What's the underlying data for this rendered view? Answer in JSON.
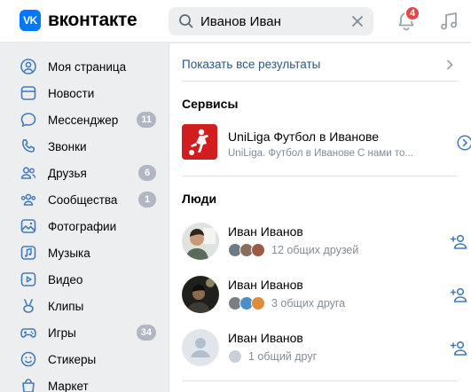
{
  "header": {
    "logo_mark": "VK",
    "logo_text": "вконтакте",
    "search_value": "Иванов Иван",
    "notification_count": "4"
  },
  "sidebar": {
    "items": [
      {
        "label": "Моя страница",
        "icon": "user-circle-icon",
        "count": ""
      },
      {
        "label": "Новости",
        "icon": "newsfeed-icon",
        "count": ""
      },
      {
        "label": "Мессенджер",
        "icon": "message-icon",
        "count": "11"
      },
      {
        "label": "Звонки",
        "icon": "phone-icon",
        "count": ""
      },
      {
        "label": "Друзья",
        "icon": "friends-icon",
        "count": "6"
      },
      {
        "label": "Сообщества",
        "icon": "communities-icon",
        "count": "1"
      },
      {
        "label": "Фотографии",
        "icon": "photo-icon",
        "count": ""
      },
      {
        "label": "Музыка",
        "icon": "music-icon",
        "count": ""
      },
      {
        "label": "Видео",
        "icon": "video-icon",
        "count": ""
      },
      {
        "label": "Клипы",
        "icon": "clips-icon",
        "count": ""
      },
      {
        "label": "Игры",
        "icon": "games-icon",
        "count": "34"
      },
      {
        "label": "Стикеры",
        "icon": "smile-icon",
        "count": ""
      },
      {
        "label": "Маркет",
        "icon": "market-icon",
        "count": ""
      }
    ]
  },
  "results": {
    "show_all": "Показать все результаты",
    "services_title": "Сервисы",
    "service": {
      "title": "UniLiga Футбол в Иванове",
      "description": "UniLiga. Футбол в Иванове С нами то..."
    },
    "people_title": "Люди",
    "people": [
      {
        "name": "Иван Иванов",
        "mutual": "12 общих друзей"
      },
      {
        "name": "Иван Иванов",
        "mutual": "3 общих друга"
      },
      {
        "name": "Иван Иванов",
        "mutual": "1 общий друг"
      }
    ]
  },
  "colors": {
    "accent": "#0077ff",
    "link": "#2a5885",
    "muted": "#818c99",
    "badge_red": "#e64646",
    "counter_grey": "#aeb7c2",
    "icon_blue": "#447bba"
  }
}
